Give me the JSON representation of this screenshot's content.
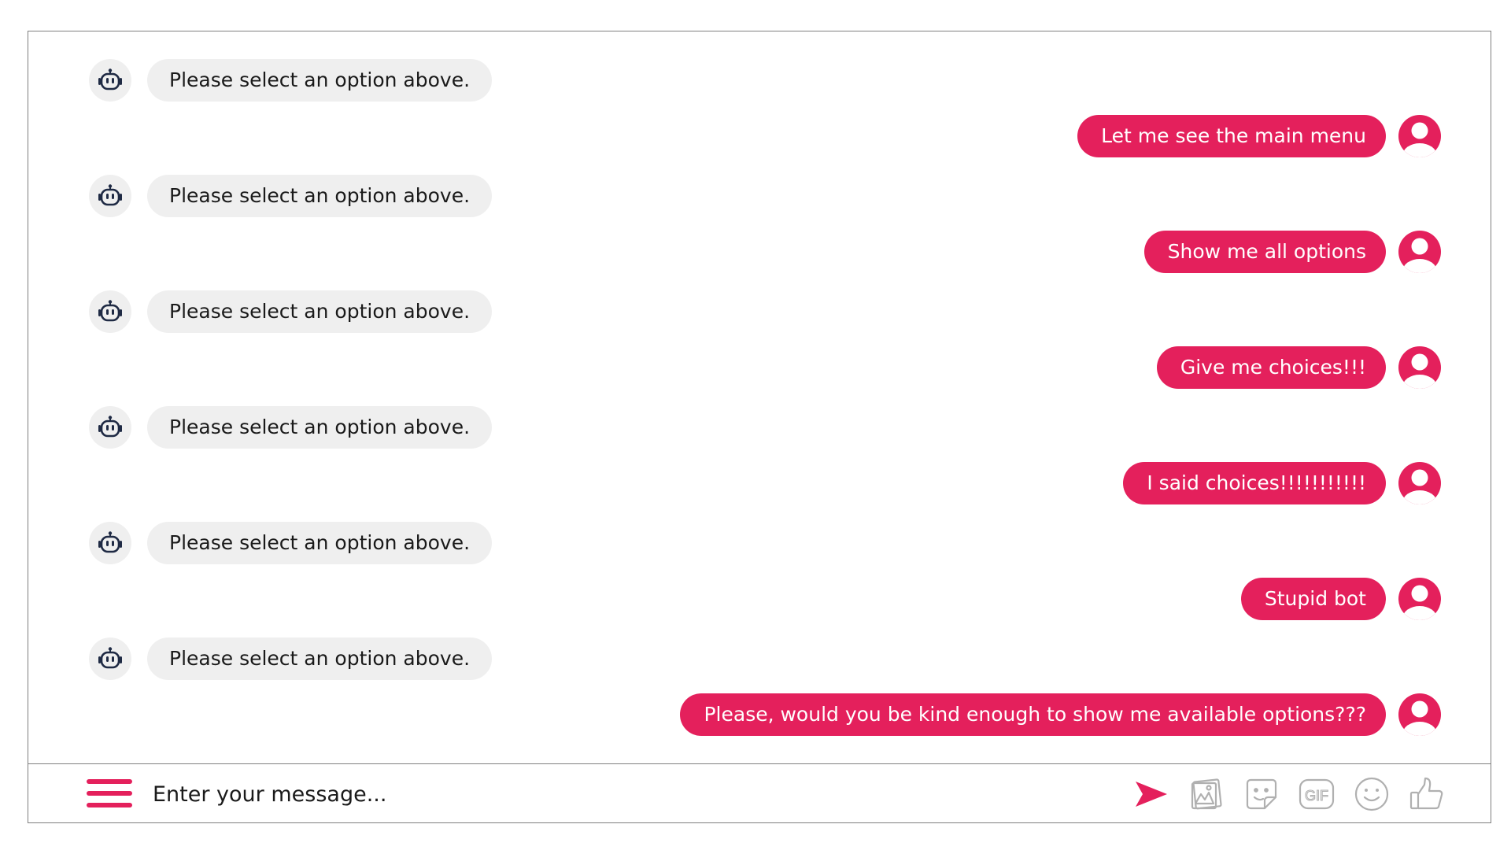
{
  "colors": {
    "accent": "#e4205c",
    "bot_bubble": "#efefef",
    "text_dark": "#1a1a1a",
    "icon_gray": "#b0b0b0",
    "border": "#7f7f7f"
  },
  "messages": [
    {
      "sender": "bot",
      "text": "Please select an option above.",
      "avatar_icon": "robot-icon"
    },
    {
      "sender": "user",
      "text": "Let me see the main menu",
      "avatar_icon": "user-icon"
    },
    {
      "sender": "bot",
      "text": "Please select an option above.",
      "avatar_icon": "robot-icon"
    },
    {
      "sender": "user",
      "text": "Show me all options",
      "avatar_icon": "user-icon"
    },
    {
      "sender": "bot",
      "text": "Please select an option above.",
      "avatar_icon": "robot-icon"
    },
    {
      "sender": "user",
      "text": "Give me choices!!!",
      "avatar_icon": "user-icon"
    },
    {
      "sender": "bot",
      "text": "Please select an option above.",
      "avatar_icon": "robot-icon"
    },
    {
      "sender": "user",
      "text": "I said choices!!!!!!!!!!!",
      "avatar_icon": "user-icon"
    },
    {
      "sender": "bot",
      "text": "Please select an option above.",
      "avatar_icon": "robot-icon"
    },
    {
      "sender": "user",
      "text": "Stupid bot",
      "avatar_icon": "user-icon"
    },
    {
      "sender": "bot",
      "text": "Please select an option above.",
      "avatar_icon": "robot-icon"
    },
    {
      "sender": "user",
      "text": "Please, would you be kind enough to show me available options???",
      "avatar_icon": "user-icon"
    }
  ],
  "input_bar": {
    "menu_icon": "hamburger-menu-icon",
    "placeholder": "Enter your message...",
    "value": "",
    "tools": [
      {
        "name": "send-icon"
      },
      {
        "name": "image-icon"
      },
      {
        "name": "sticker-icon"
      },
      {
        "name": "gif-icon",
        "label": "GIF"
      },
      {
        "name": "emoji-icon"
      },
      {
        "name": "thumbs-up-icon"
      }
    ]
  }
}
